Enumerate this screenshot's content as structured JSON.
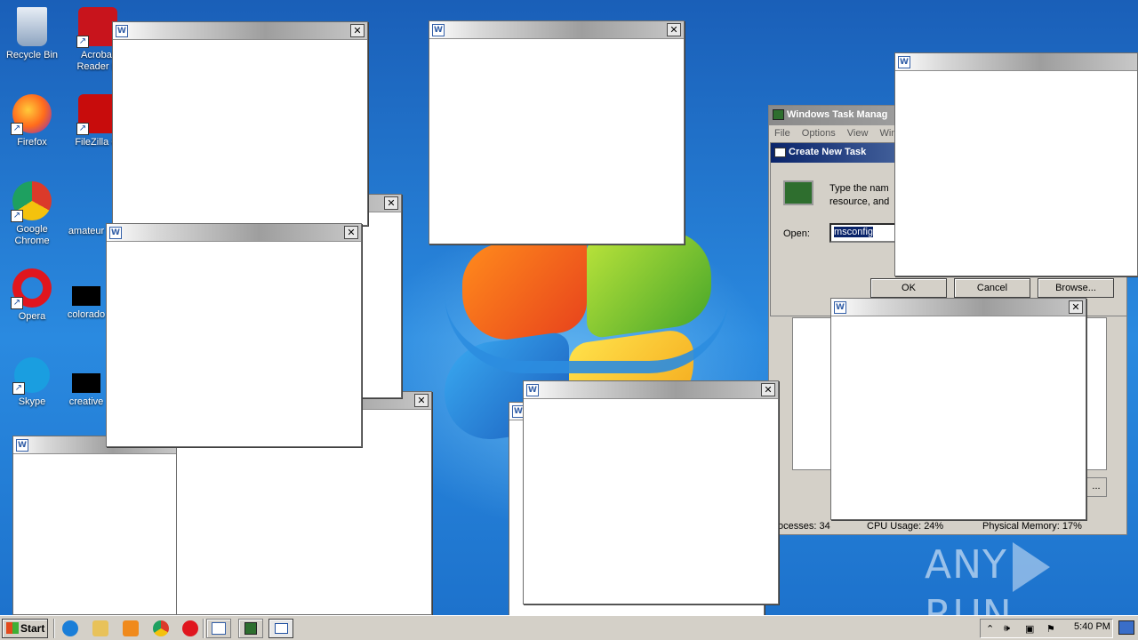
{
  "desktop_icons": [
    {
      "label": "Recycle Bin",
      "icon": "recycle-bin-icon"
    },
    {
      "label": "Acrobat Reader D",
      "icon": "acrobat-reader-icon"
    },
    {
      "label": "Firefox",
      "icon": "firefox-icon"
    },
    {
      "label": "FileZilla Cl",
      "icon": "filezilla-icon"
    },
    {
      "label": "Google Chrome",
      "icon": "chrome-icon"
    },
    {
      "label": "amateur",
      "icon": "document-icon"
    },
    {
      "label": "Opera",
      "icon": "opera-icon"
    },
    {
      "label": "colorado",
      "icon": "document-icon"
    },
    {
      "label": "Skype",
      "icon": "skype-icon"
    },
    {
      "label": "creative",
      "icon": "document-icon"
    }
  ],
  "word_window": {
    "close_glyph": "✕",
    "icon_glyph": "W"
  },
  "task_manager": {
    "title": "Windows Task Manag",
    "menu": [
      "File",
      "Options",
      "View",
      "Winc"
    ],
    "status": {
      "processes": "ocesses: 34",
      "cpu": "CPU Usage: 24%",
      "memory": "Physical Memory: 17%"
    },
    "ellipsis_button": "..."
  },
  "create_new_task": {
    "title": "Create New Task",
    "description_line1": "Type the nam",
    "description_line2": "resource, and",
    "open_label": "Open:",
    "open_value": "msconfig",
    "ok": "OK",
    "cancel": "Cancel",
    "browse": "Browse..."
  },
  "watermark": {
    "left": "ANY",
    "right": "RUN"
  },
  "taskbar": {
    "start_label": "Start",
    "clock": "5:40 PM"
  }
}
